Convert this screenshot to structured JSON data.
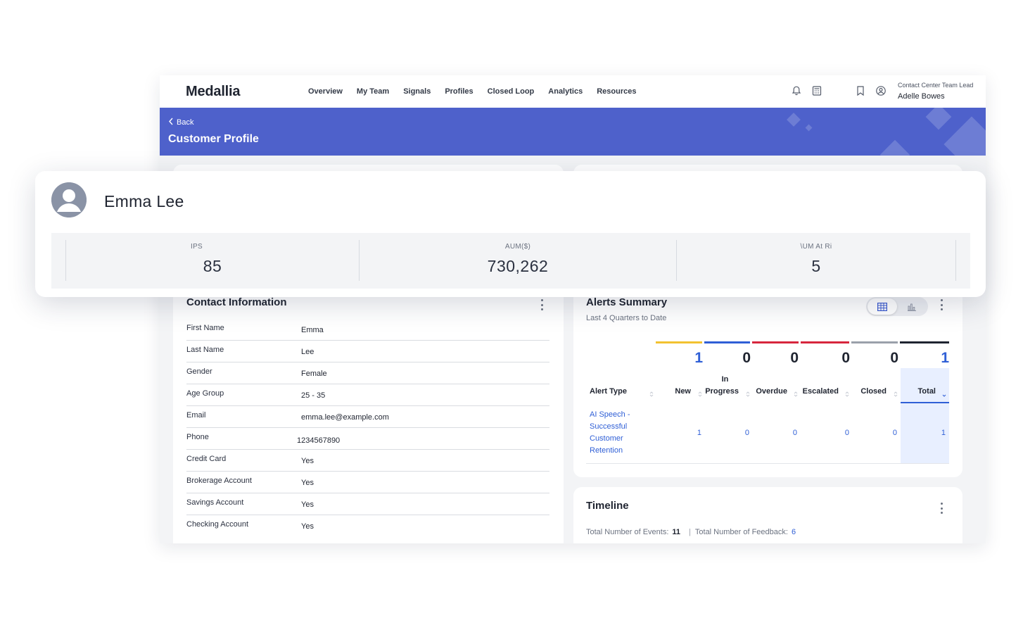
{
  "app": {
    "logo": "Medallia",
    "nav": [
      "Overview",
      "My Team",
      "Signals",
      "Profiles",
      "Closed Loop",
      "Analytics",
      "Resources"
    ],
    "user": {
      "role": "Contact Center Team Lead",
      "name": "Adelle Bowes"
    },
    "icons": [
      "bell-icon",
      "calculator-icon",
      "bookmark-icon",
      "user-circle-icon"
    ]
  },
  "banner": {
    "back": "Back",
    "title": "Customer Profile",
    "color": "#4e61cb"
  },
  "profile": {
    "name": "Emma Lee",
    "metrics": [
      {
        "label": "IPS",
        "value": "85"
      },
      {
        "label": "AUM($)",
        "value": "730,262"
      },
      {
        "label": "\\UM At Ri",
        "value": "5"
      }
    ]
  },
  "contact": {
    "title": "Contact Information",
    "rows": [
      {
        "label": "First Name",
        "value": "Emma"
      },
      {
        "label": "Last Name",
        "value": "Lee"
      },
      {
        "label": "Gender",
        "value": "Female"
      },
      {
        "label": "Age Group",
        "value": "25 - 35"
      },
      {
        "label": "Email",
        "value": "emma.lee@example.com"
      },
      {
        "label": "Phone",
        "value": "1234567890"
      },
      {
        "label": "Credit Card",
        "value": "Yes"
      },
      {
        "label": "Brokerage Account",
        "value": "Yes"
      },
      {
        "label": "Savings Account",
        "value": "Yes"
      },
      {
        "label": "Checking Account",
        "value": "Yes"
      }
    ]
  },
  "alerts": {
    "title": "Alerts Summary",
    "subtitle": "Last 4 Quarters to Date",
    "view_toggle": [
      "table-view-icon",
      "chart-view-icon"
    ],
    "columns": [
      {
        "label": "Alert Type"
      },
      {
        "label": "New",
        "count": "1",
        "color": "#f2c230"
      },
      {
        "label_top": "In",
        "label": "Progress",
        "count": "0",
        "color": "#2f5fd6"
      },
      {
        "label": "Overdue",
        "count": "0",
        "color": "#d7263d"
      },
      {
        "label": "Escalated",
        "count": "0",
        "color": "#d7263d"
      },
      {
        "label": "Closed",
        "count": "0",
        "color": "#9aa0aa"
      },
      {
        "label": "Total",
        "count": "1",
        "color": "#1f2430"
      }
    ],
    "rows": [
      {
        "type_lines": [
          "AI Speech -",
          "Successful",
          "Customer",
          "Retention"
        ],
        "values": [
          "1",
          "0",
          "0",
          "0",
          "0",
          "1"
        ]
      }
    ]
  },
  "timeline": {
    "title": "Timeline",
    "events_label": "Total Number of Events:",
    "events_value": "11",
    "feedback_label": "Total Number of Feedback:",
    "feedback_value": "6"
  }
}
